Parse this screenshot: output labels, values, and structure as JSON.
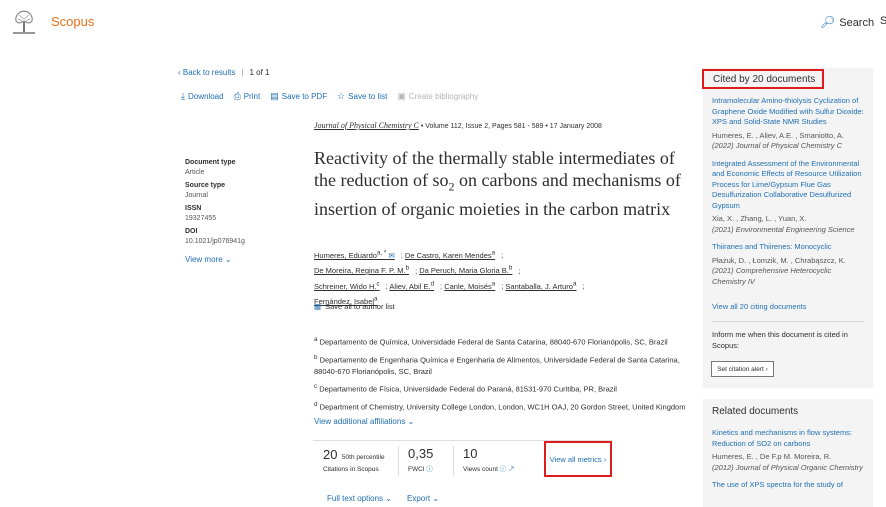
{
  "header": {
    "brand": "Scopus",
    "search_label": "Search",
    "search_icon": "search-icon",
    "truncated_label": "S"
  },
  "nav": {
    "back_label": "‹ Back to results",
    "page_current": "1",
    "page_of": "of",
    "page_total": "1"
  },
  "toolbar": {
    "download": "Download",
    "print": "Print",
    "save_pdf": "Save to PDF",
    "save_list": "Save to list",
    "create_bib": "Create bibliography"
  },
  "journal": {
    "name": "Journal of Physical Chemistry C",
    "details": "• Volume 112, Issue 2, Pages 581 - 589 • 17 January 2008"
  },
  "meta": {
    "doc_type_label": "Document type",
    "doc_type": "Article",
    "source_type_label": "Source type",
    "source_type": "Journal",
    "issn_label": "ISSN",
    "issn": "19327455",
    "doi_label": "DOI",
    "doi": "10.1021/jp076941g",
    "view_more": "View more"
  },
  "article": {
    "title_part1": "Reactivity of the thermally stable intermediates of the reduction of so",
    "title_sub": "2",
    "title_part2": " on carbons and mechanisms of insertion of organic moieties in the carbon matrix"
  },
  "authors": [
    {
      "name": "Humeres, Eduardo",
      "sup": "a, *"
    },
    {
      "name": "De Castro, Karen Mendes",
      "sup": "a"
    },
    {
      "name": "De Moreira, Regina F. P. M.",
      "sup": "b"
    },
    {
      "name": "Da Peruch, Maria Gloria B.",
      "sup": "b"
    },
    {
      "name": "Schreiner, Wido H.",
      "sup": "c"
    },
    {
      "name": "Aliev, Abil E.",
      "sup": "d"
    },
    {
      "name": "Canle, Moisés",
      "sup": "a"
    },
    {
      "name": "Santaballa, J. Arturo",
      "sup": "a"
    },
    {
      "name": "Fernández, Isabel",
      "sup": "a"
    }
  ],
  "save_authors": "Save all to author list",
  "affiliations": [
    {
      "sup": "a",
      "text": "Departamento de Química, Universidade Federal de Santa Catarina, 88040-670 Florianópolis, SC, Brazil"
    },
    {
      "sup": "b",
      "text": "Departamento de Engenharia Química e Engenharia de Alimentos, Universidade Federal de Santa Catarina, 88040-670 Florianópolis, SC, Brazil"
    },
    {
      "sup": "c",
      "text": "Departamento de Física, Universidade Federal do Paraná, 81531-970 Curitiba, PR, Brazil"
    },
    {
      "sup": "d",
      "text": "Department of Chemistry, University College London, London, WC1H OAJ, 20 Gordon Street, United Kingdom"
    }
  ],
  "view_affiliations": "View additional affiliations",
  "metrics": {
    "citations_value": "20",
    "citations_percentile": "50th percentile",
    "citations_label": "Citations in Scopus",
    "fwci_value": "0,35",
    "fwci_label": "FWCI",
    "views_value": "10",
    "views_label": "Views count",
    "view_all": "View all metrics"
  },
  "bottom": {
    "full_text": "Full text options",
    "export": "Export"
  },
  "cited_by": {
    "header": "Cited by 20 documents",
    "items": [
      {
        "title": "Intramolecular Amino-thiolysis Cyclization of Graphene Oxide Modified with Sulfur Dioxide: XPS and Solid-State NMR Studies",
        "authors": "Humeres, E. , Aliev, A.E. , Smaniotto, A.",
        "source": "(2022) Journal of Physical Chemistry C"
      },
      {
        "title": "Integrated Assessment of the Environmental and Economic Effects of Resource Utilization Process for Lime/Gypsum Flue Gas Desulfurization Collaborative Desulfurized Gypsum",
        "authors": "Xia, X. , Zhang, L. , Yuan, X.",
        "source": "(2021) Environmental Engineering Science"
      },
      {
        "title": "Thiiranes and Thiirenes: Monocyclic",
        "authors": "Płażuk, D. , Łomzik, M. , Chrabąszcz, K.",
        "source": "(2021) Comprehensive Heterocyclic Chemistry IV"
      }
    ],
    "view_all": "View all 20 citing documents",
    "inform": "Inform me when this document is cited in Scopus:",
    "set_alert": "Set citation alert ›"
  },
  "related": {
    "header": "Related documents",
    "items": [
      {
        "title": "Kinetics and mechanisms in flow systems: Reduction of SO2 on carbons",
        "authors": "Humeres, E. , De F.p M. Moreira, R.",
        "source": "(2012) Journal of Physical Organic Chemistry"
      },
      {
        "title": "The use of XPS spectra for the study of",
        "authors": "",
        "source": ""
      }
    ]
  },
  "colors": {
    "brand": "#e9711c",
    "link": "#1f6fb2",
    "highlight_box": "#e01b1b",
    "panel_bg": "#f4f4f4"
  }
}
